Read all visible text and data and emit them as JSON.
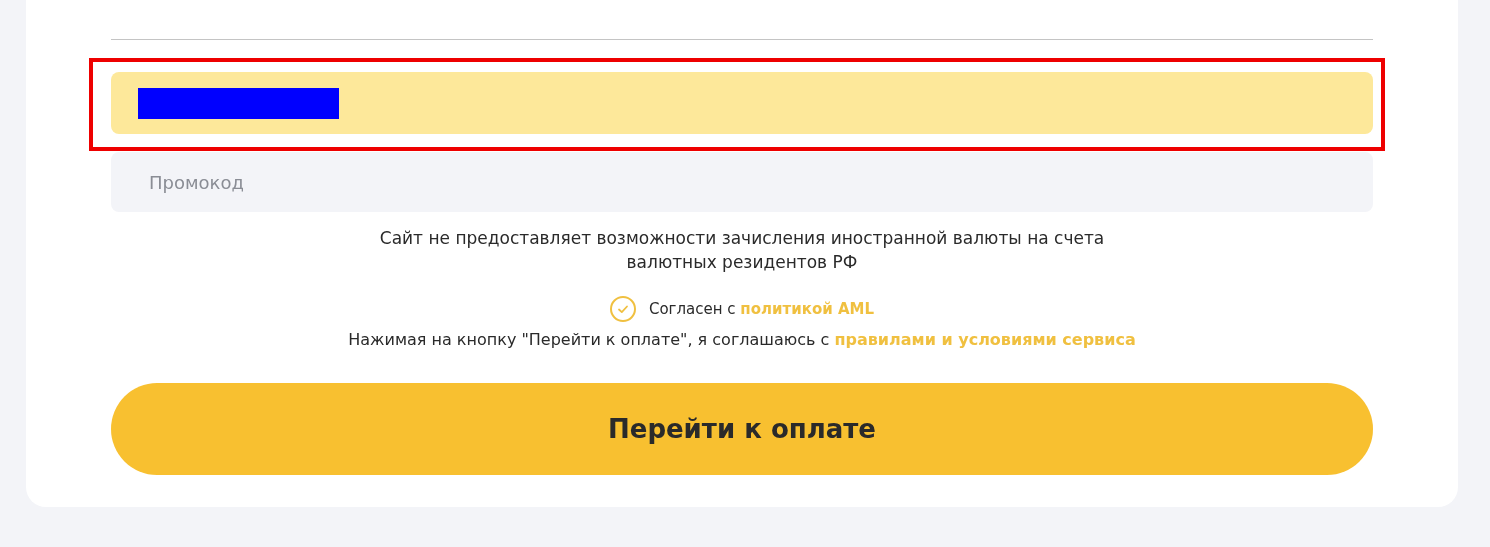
{
  "wallet_field": {
    "redacted": true,
    "highlighted": true
  },
  "promo_field": {
    "placeholder": "Промокод"
  },
  "notice": "Сайт не предоставляет возможности зачисления иностранной валюты на счета валютных резидентов РФ",
  "aml_agreement": {
    "checked": true,
    "text": "Согласен с ",
    "link": "политикой AML"
  },
  "terms": {
    "text": "Нажимая на кнопку \"Перейти к оплате\", я соглашаюсь с ",
    "link": "правилами и условиями сервиса"
  },
  "pay_button": {
    "label": "Перейти к оплате"
  }
}
